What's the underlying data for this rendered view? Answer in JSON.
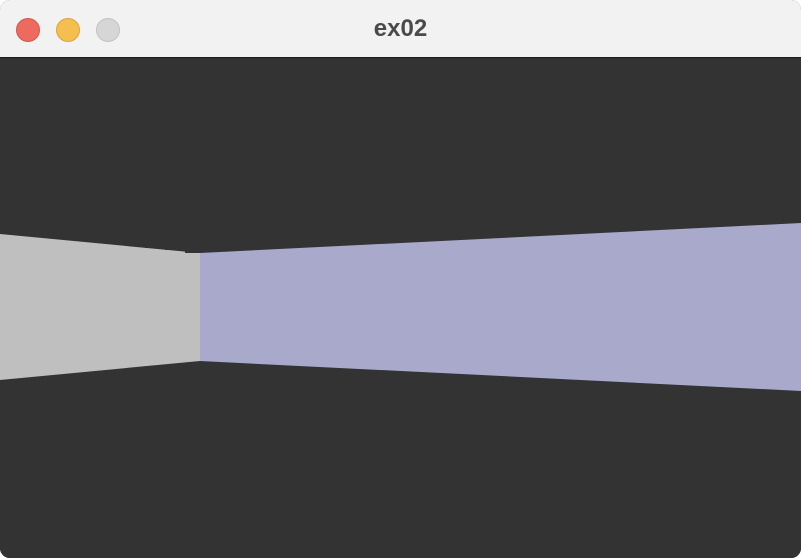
{
  "window": {
    "title": "ex02"
  },
  "traffic_lights": {
    "close_color": "#ec6a5e",
    "minimize_color": "#f4bf4f",
    "zoom_color": "#d6d6d6"
  },
  "scene": {
    "background_color": "#333333",
    "wall_colors": {
      "near_wall": "#bfbfbf",
      "far_wall": "#a9a9cc"
    }
  }
}
